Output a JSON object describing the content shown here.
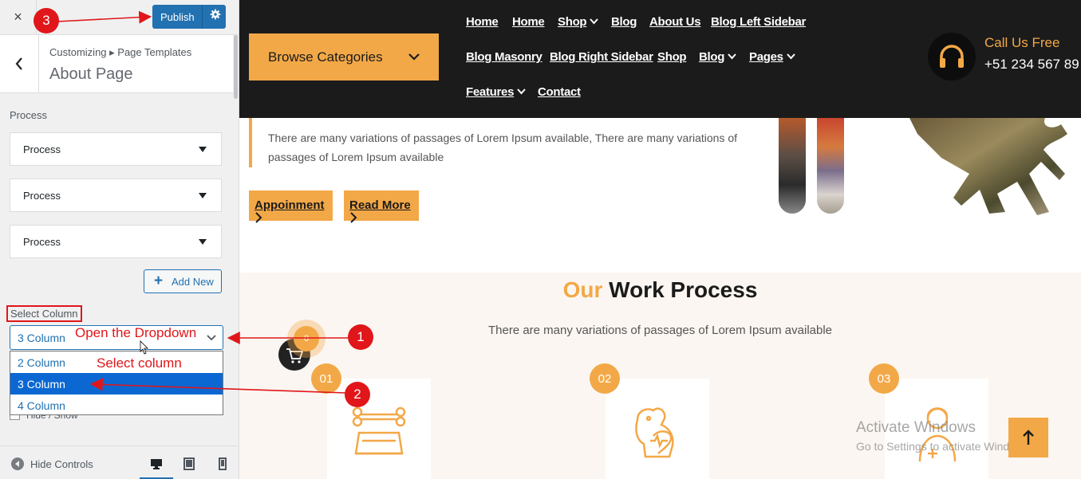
{
  "customizer": {
    "close": "×",
    "publish_label": "Publish",
    "breadcrumb": "Customizing ▸ Page Templates",
    "page_title": "About Page",
    "process_heading": "Process",
    "process_items": [
      "Process",
      "Process",
      "Process"
    ],
    "add_new": "Add New",
    "select_column_label": "Select Column",
    "select_column_value": "3 Column",
    "column_options": [
      "2 Column",
      "3 Column",
      "4 Column"
    ],
    "selected_option": "3 Column",
    "hide_show_peek": "Hide / Show",
    "hide_controls": "Hide Controls"
  },
  "preview": {
    "browse_categories": "Browse Categories",
    "nav_row1": [
      "Home",
      "Home",
      "Shop",
      "Blog",
      "About Us",
      "Blog Left Sidebar"
    ],
    "nav_row2": [
      "Blog Masonry",
      "Blog Right Sidebar",
      "Shop",
      "Blog",
      "Pages"
    ],
    "nav_row3": [
      "Features",
      "Contact"
    ],
    "call_label": "Call Us Free",
    "call_number": "+51 234 567 89",
    "hero_text": "There are many variations of passages of Lorem Ipsum available, There are many variations of passages of Lorem Ipsum available",
    "btn_appointment": "Appoinment",
    "btn_read_more": "Read More",
    "work_title_highlight": "Our",
    "work_title_rest": " Work Process",
    "work_subtitle": "There are many variations of passages of Lorem Ipsum available",
    "steps": [
      "01",
      "02",
      "03"
    ],
    "cart_count": "0",
    "watermark_title": "Activate Windows",
    "watermark_sub": "Go to Settings to activate Windows."
  },
  "annotations": {
    "step1": "1",
    "step2": "2",
    "step3": "3",
    "open_dropdown": "Open the Dropdown",
    "select_column": "Select column"
  },
  "colors": {
    "accent": "#f3a847",
    "wp_blue": "#2271b1",
    "annotation_red": "#e0161a",
    "nav_bg": "#1b1b1b"
  }
}
